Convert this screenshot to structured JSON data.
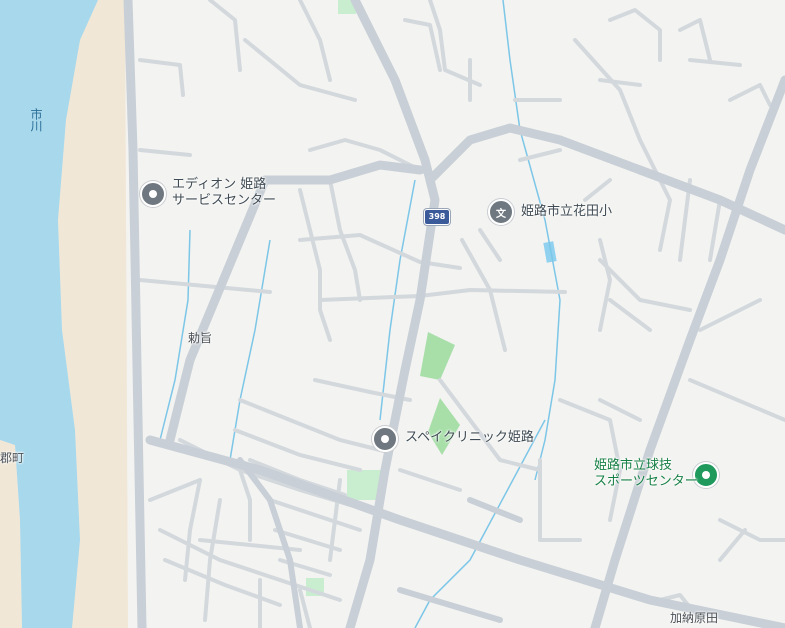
{
  "map": {
    "river_name": "市川",
    "road_shield": "398",
    "pois": [
      {
        "name_line1": "エディオン 姫路",
        "name_line2": "サービスセンター",
        "kind": "shop"
      },
      {
        "name_line1": "姫路市立花田小",
        "kind": "school"
      },
      {
        "name_line1": "スペイクリニック姫路",
        "kind": "clinic"
      },
      {
        "name_line1": "姫路市立球技",
        "name_line2": "スポーツセンター",
        "kind": "park"
      }
    ],
    "areas": {
      "chokushi": "勅旨",
      "kanoharada": "加納原田",
      "edge_town": "郡町"
    },
    "colors": {
      "land": "#f3f3f1",
      "river": "#a7d8ec",
      "sand": "#f1e7d6",
      "green": "#c8eecf",
      "park": "#a8dfa9",
      "road_major": "#c8cfd6",
      "road_minor": "#cfd5db",
      "stream": "#7cc6e7",
      "poi_pin": "#6f7880",
      "park_pin": "#1f9a5c"
    }
  }
}
